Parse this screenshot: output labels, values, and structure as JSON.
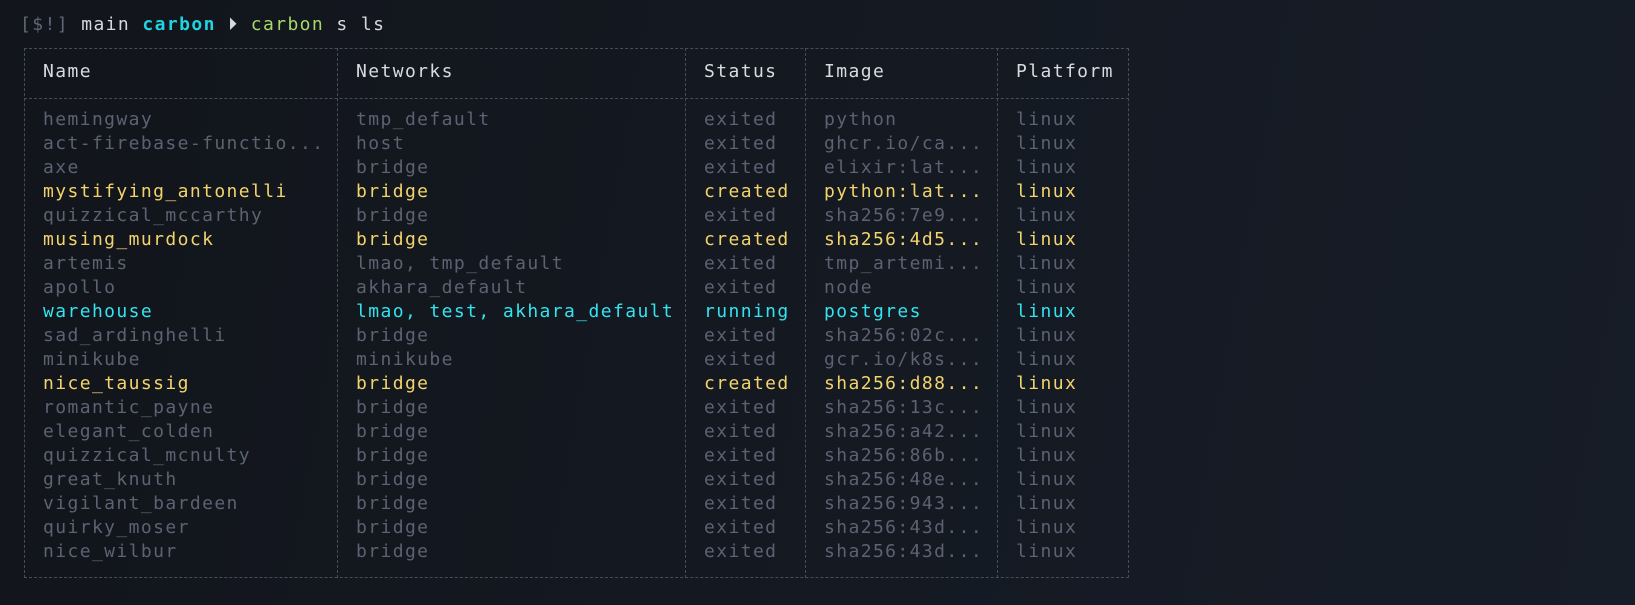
{
  "prompt": {
    "status": "[$!]",
    "branch": "main",
    "host": "carbon",
    "arrow": "⏵",
    "dir": "carbon",
    "command": "s ls"
  },
  "table": {
    "headers": [
      "Name",
      "Networks",
      "Status",
      "Image",
      "Platform"
    ],
    "rows": [
      {
        "name": "hemingway",
        "networks": "tmp_default",
        "status": "exited",
        "image": "python",
        "platform": "linux"
      },
      {
        "name": "act-firebase-functio...",
        "networks": "host",
        "status": "exited",
        "image": "ghcr.io/ca...",
        "platform": "linux"
      },
      {
        "name": "axe",
        "networks": "bridge",
        "status": "exited",
        "image": "elixir:lat...",
        "platform": "linux"
      },
      {
        "name": "mystifying_antonelli",
        "networks": "bridge",
        "status": "created",
        "image": "python:lat...",
        "platform": "linux"
      },
      {
        "name": "quizzical_mccarthy",
        "networks": "bridge",
        "status": "exited",
        "image": "sha256:7e9...",
        "platform": "linux"
      },
      {
        "name": "musing_murdock",
        "networks": "bridge",
        "status": "created",
        "image": "sha256:4d5...",
        "platform": "linux"
      },
      {
        "name": "artemis",
        "networks": "lmao, tmp_default",
        "status": "exited",
        "image": "tmp_artemi...",
        "platform": "linux"
      },
      {
        "name": "apollo",
        "networks": "akhara_default",
        "status": "exited",
        "image": "node",
        "platform": "linux"
      },
      {
        "name": "warehouse",
        "networks": "lmao, test, akhara_default",
        "status": "running",
        "image": "postgres",
        "platform": "linux"
      },
      {
        "name": "sad_ardinghelli",
        "networks": "bridge",
        "status": "exited",
        "image": "sha256:02c...",
        "platform": "linux"
      },
      {
        "name": "minikube",
        "networks": "minikube",
        "status": "exited",
        "image": "gcr.io/k8s...",
        "platform": "linux"
      },
      {
        "name": "nice_taussig",
        "networks": "bridge",
        "status": "created",
        "image": "sha256:d88...",
        "platform": "linux"
      },
      {
        "name": "romantic_payne",
        "networks": "bridge",
        "status": "exited",
        "image": "sha256:13c...",
        "platform": "linux"
      },
      {
        "name": "elegant_colden",
        "networks": "bridge",
        "status": "exited",
        "image": "sha256:a42...",
        "platform": "linux"
      },
      {
        "name": "quizzical_mcnulty",
        "networks": "bridge",
        "status": "exited",
        "image": "sha256:86b...",
        "platform": "linux"
      },
      {
        "name": "great_knuth",
        "networks": "bridge",
        "status": "exited",
        "image": "sha256:48e...",
        "platform": "linux"
      },
      {
        "name": "vigilant_bardeen",
        "networks": "bridge",
        "status": "exited",
        "image": "sha256:943...",
        "platform": "linux"
      },
      {
        "name": "quirky_moser",
        "networks": "bridge",
        "status": "exited",
        "image": "sha256:43d...",
        "platform": "linux"
      },
      {
        "name": "nice_wilbur",
        "networks": "bridge",
        "status": "exited",
        "image": "sha256:43d...",
        "platform": "linux"
      }
    ]
  },
  "colors": {
    "exited": "#5b6272",
    "created": "#f2d46b",
    "running": "#33e3ef",
    "host": "#1fd3e0",
    "dir": "#a6d86a"
  }
}
